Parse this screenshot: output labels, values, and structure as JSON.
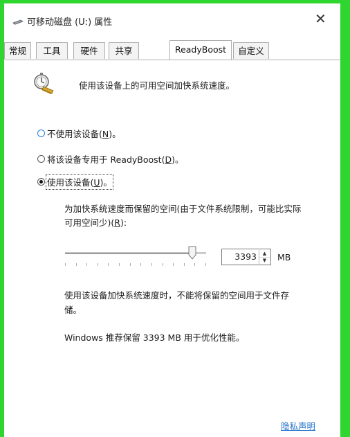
{
  "window": {
    "title": "可移动磁盘 (U:) 属性",
    "close_glyph": "✕"
  },
  "tabs": [
    {
      "label": "常规",
      "active": false
    },
    {
      "label": "工具",
      "active": false
    },
    {
      "label": "硬件",
      "active": false
    },
    {
      "label": "共享",
      "active": false
    },
    {
      "label": "ReadyBoost",
      "active": true
    },
    {
      "label": "自定义",
      "active": false
    }
  ],
  "header_text": "使用该设备上的可用空间加快系统速度。",
  "options": {
    "dont_use": {
      "label": "不使用该设备(",
      "key": "N",
      "suffix": ")。",
      "selected": false
    },
    "dedicate": {
      "label": "将该设备专用于 ReadyBoost(",
      "key": "D",
      "suffix": ")。",
      "selected": false
    },
    "use": {
      "label": "使用该设备(",
      "key": "U",
      "suffix": ")。",
      "selected": true
    }
  },
  "reserve": {
    "description_line1": "为加快系统速度而保留的空间(由于文件系统限制，可能比实际",
    "description_line2": "可用空间少)(",
    "description_key": "R",
    "description_suffix": "):",
    "slider_fraction": 0.9,
    "value": "3393",
    "unit": "MB"
  },
  "note_line1": "使用该设备加快系统速度时，不能将保留的空间用于文件存",
  "note_line2": "储。",
  "recommendation": "Windows 推荐保留 3393 MB 用于优化性能。",
  "privacy_link": "隐私声明",
  "icons": {
    "title": "drive-icon",
    "header": "stopwatch-icon",
    "spin_up": "up-arrow-icon",
    "spin_down": "down-arrow-icon"
  },
  "colors": {
    "frame_border": "#2fd62f",
    "link": "#1f6fc9",
    "radio_accent": "#2a7bd8"
  }
}
